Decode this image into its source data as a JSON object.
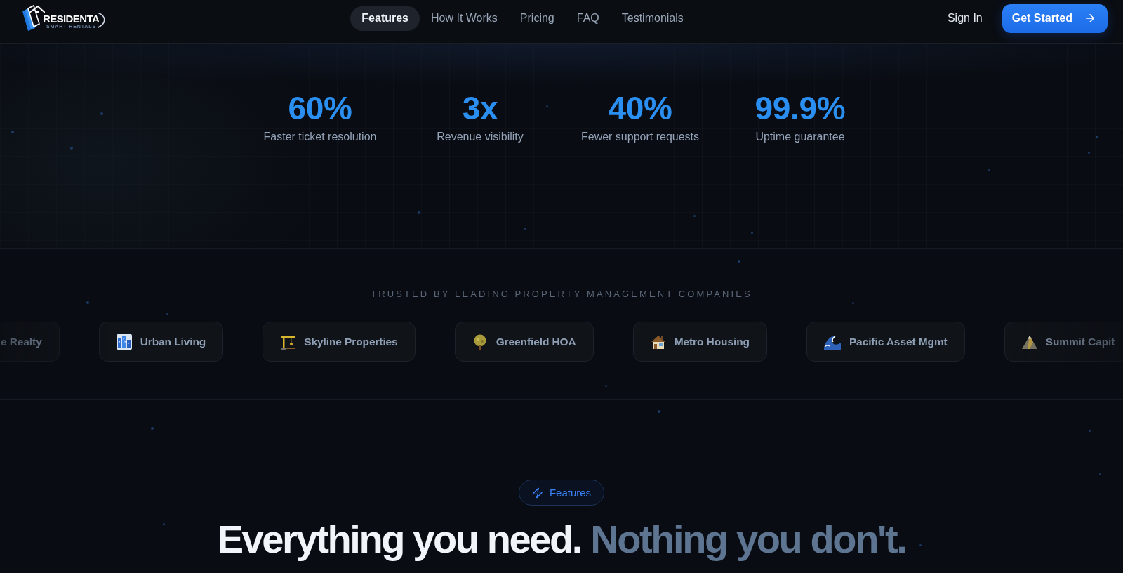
{
  "header": {
    "logo": {
      "name": "RESIDENTA",
      "tagline": "SMART RENTALS"
    },
    "nav": [
      {
        "label": "Features",
        "selected": true
      },
      {
        "label": "How It Works",
        "selected": false
      },
      {
        "label": "Pricing",
        "selected": false
      },
      {
        "label": "FAQ",
        "selected": false
      },
      {
        "label": "Testimonials",
        "selected": false
      }
    ],
    "sign_in": "Sign In",
    "cta": "Get Started"
  },
  "stats": [
    {
      "value": "60%",
      "label": "Faster ticket resolution"
    },
    {
      "value": "3x",
      "label": "Revenue visibility"
    },
    {
      "value": "40%",
      "label": "Fewer support requests"
    },
    {
      "value": "99.9%",
      "label": "Uptime guarantee"
    }
  ],
  "trusted": {
    "title": "TRUSTED BY LEADING PROPERTY MANAGEMENT COMPANIES",
    "companies": [
      {
        "name": "e Realty"
      },
      {
        "name": "Urban Living"
      },
      {
        "name": "Skyline Properties"
      },
      {
        "name": "Greenfield HOA"
      },
      {
        "name": "Metro Housing"
      },
      {
        "name": "Pacific Asset Mgmt"
      },
      {
        "name": "Summit Capit"
      }
    ]
  },
  "features": {
    "badge": "Features",
    "heading": {
      "lead": "Everything you need.",
      "accent": "Nothing you don't."
    }
  }
}
